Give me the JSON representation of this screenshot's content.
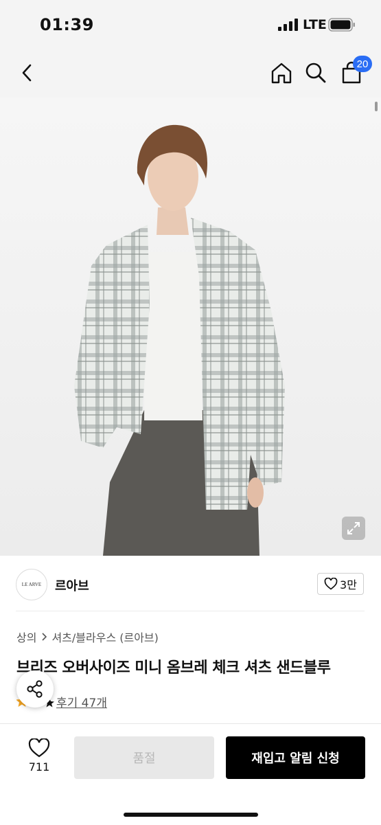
{
  "status_bar": {
    "time": "01:39",
    "network": "LTE"
  },
  "nav": {
    "back_icon": "chevron-left-icon",
    "home_icon": "home-icon",
    "search_icon": "search-icon",
    "cart_icon": "cart-icon",
    "cart_count": "20"
  },
  "product_image": {
    "expand_icon": "expand-icon"
  },
  "brand": {
    "logo_text": "LE ARVE",
    "name": "르아브",
    "like_count": "3만"
  },
  "breadcrumb": {
    "level1": "상의",
    "level2": "셔츠/블라우스 (르아브)"
  },
  "product": {
    "title": "브리즈 오버사이즈 미니 옴브레 체크 셔츠 샌드블루",
    "review_label": "후기 47개"
  },
  "bottom_bar": {
    "wish_count": "711",
    "soldout_label": "품절",
    "restock_label": "재입고 알림 신청"
  },
  "colors": {
    "badge": "#2a6df4",
    "primary_button": "#000000",
    "disabled_button": "#e8e8e8"
  }
}
